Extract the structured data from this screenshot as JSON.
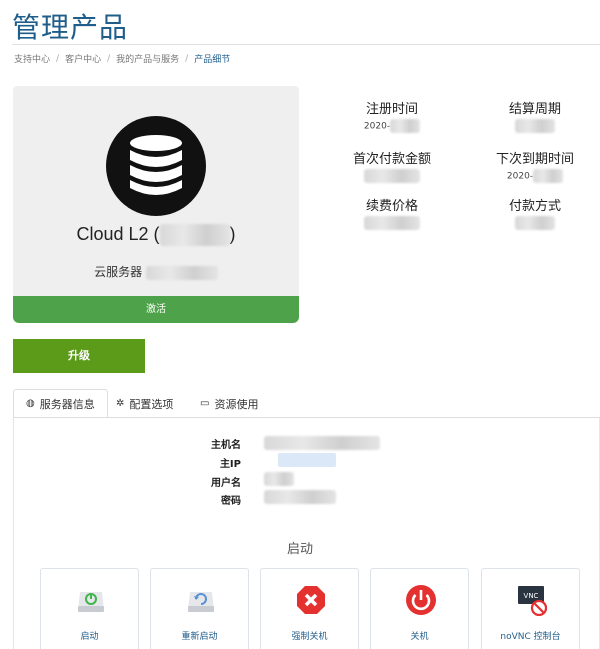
{
  "page": {
    "title": "管理产品"
  },
  "breadcrumb": [
    {
      "label": "支持中心"
    },
    {
      "label": "客户中心"
    },
    {
      "label": "我的产品与服务"
    },
    {
      "label": "产品细节"
    }
  ],
  "product": {
    "name_prefix": "Cloud L2 (",
    "name_suffix": ")",
    "type_label": "云服务器",
    "status": "激活",
    "icon": "database-icon"
  },
  "billing": {
    "registration_label": "注册时间",
    "registration_value": "2020-",
    "cycle_label": "结算周期",
    "first_payment_label": "首次付款金额",
    "next_due_label": "下次到期时间",
    "next_due_value": "2020-",
    "renewal_label": "续费价格",
    "payment_method_label": "付款方式"
  },
  "upgrade": {
    "label": "升级"
  },
  "tabs": [
    {
      "label": "服务器信息",
      "icon": "info-circle-icon"
    },
    {
      "label": "配置选项",
      "icon": "cogs-icon"
    },
    {
      "label": "资源使用",
      "icon": "hdd-icon"
    }
  ],
  "server_info": {
    "hostname_label": "主机名",
    "main_ip_label": "主IP",
    "username_label": "用户名",
    "password_label": "密码"
  },
  "actions": {
    "section_title": "启动",
    "items": [
      {
        "label": "启动",
        "icon": "power-on-icon"
      },
      {
        "label": "重新启动",
        "icon": "reboot-icon"
      },
      {
        "label": "强制关机",
        "icon": "force-stop-icon"
      },
      {
        "label": "关机",
        "icon": "shutdown-icon"
      },
      {
        "label": "noVNC 控制台",
        "icon": "vnc-console-icon"
      }
    ]
  },
  "colors": {
    "title": "#1f5d8a",
    "status_green": "#4ea34a",
    "upgrade_green": "#5c9a1a",
    "danger_red": "#e53030"
  }
}
